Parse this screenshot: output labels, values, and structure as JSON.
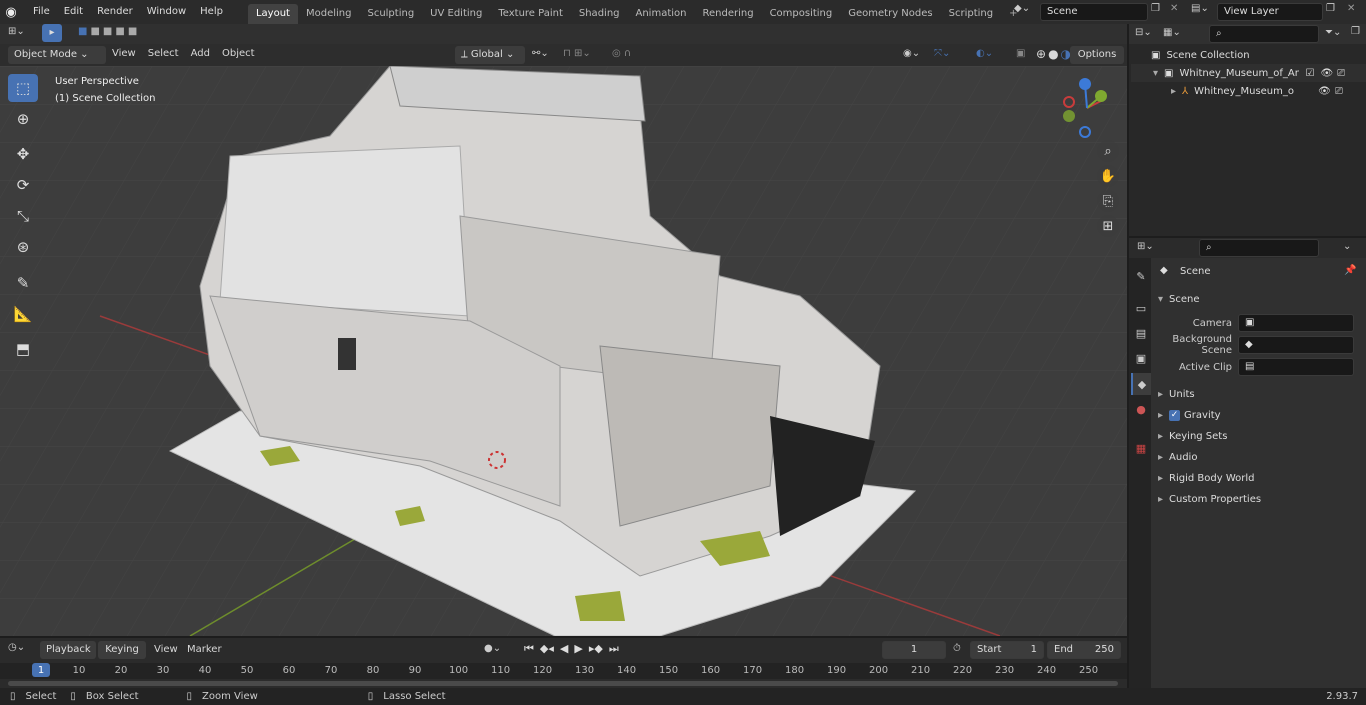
{
  "menu": [
    "File",
    "Edit",
    "Render",
    "Window",
    "Help"
  ],
  "workspaces": [
    "Layout",
    "Modeling",
    "Sculpting",
    "UV Editing",
    "Texture Paint",
    "Shading",
    "Animation",
    "Rendering",
    "Compositing",
    "Geometry Nodes",
    "Scripting"
  ],
  "active_workspace": "Layout",
  "scene_name": "Scene",
  "view_layer": "View Layer",
  "viewport": {
    "mode": "Object Mode",
    "menus": [
      "View",
      "Select",
      "Add",
      "Object"
    ],
    "orientation": "Global",
    "options": "Options",
    "overlay_line1": "User Perspective",
    "overlay_line2": "(1) Scene Collection"
  },
  "outliner": {
    "root": "Scene Collection",
    "items": [
      "Whitney_Museum_of_America",
      "Whitney_Museum_of_Am"
    ]
  },
  "properties": {
    "header": "Scene",
    "section": "Scene",
    "camera_label": "Camera",
    "bg_scene_label": "Background Scene",
    "active_clip_label": "Active Clip",
    "subsections": [
      "Units",
      "Gravity",
      "Keying Sets",
      "Audio",
      "Rigid Body World",
      "Custom Properties"
    ]
  },
  "timeline": {
    "menus": [
      "Playback",
      "Keying",
      "View",
      "Marker"
    ],
    "current_frame": "1",
    "start_label": "Start",
    "start": "1",
    "end_label": "End",
    "end": "250",
    "ruler": [
      "1",
      "10",
      "20",
      "30",
      "40",
      "50",
      "60",
      "70",
      "80",
      "90",
      "100",
      "110",
      "120",
      "130",
      "140",
      "150",
      "160",
      "170",
      "180",
      "190",
      "200",
      "210",
      "220",
      "230",
      "240",
      "250"
    ]
  },
  "status": {
    "select": "Select",
    "box_select": "Box Select",
    "zoom_view": "Zoom View",
    "lasso_select": "Lasso Select",
    "version": "2.93.7"
  },
  "colors": {
    "accent": "#4772b3",
    "axis_x": "#c83c3c",
    "axis_y": "#7fa830",
    "axis_z": "#3c7ad8"
  }
}
